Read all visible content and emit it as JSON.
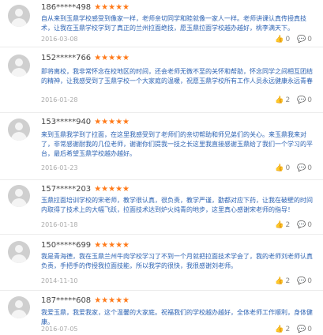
{
  "reviews": [
    {
      "user": "186*****498",
      "stars": "★★★★★",
      "content": "自从来到玉鼎学校感受到像家一样，老师亲切同学和睦就像一家人一样。老师讲课认真传授真技术，让我在玉鼎学校学到了真正的兰州拉面绝技，愿玉鼎拉面学校越办越好，桃李满天下。",
      "date": "2016-03-08",
      "likes": "0",
      "comments": "0"
    },
    {
      "user": "152*****766",
      "stars": "★★★★★",
      "content": "即将离校，我非常怀念在校地区的时间，还会老师无微不至的关怀和帮助，怀念同学之间相互团结的精神，让我感受到了玉鼎学校一个大家庭的温暖，祝愿玉鼎学校所有工作人员永远健康永远青春",
      "date": "2016-01-28",
      "likes": "2",
      "comments": "0"
    },
    {
      "user": "153*****940",
      "stars": "★★★★★",
      "content": "来到玉鼎我学到了拉面，在这里我感受到了老师们的亲切帮助和师兄弟们的关心。来玉鼎我来对了，非常感谢耐我的几位老师，谢谢你们提我一技之长这里我直接感谢玉鼎给了我们一个学习的平台，最后希望玉鼎学校越办越好。",
      "date": "2016-01-23",
      "likes": "0",
      "comments": "0"
    },
    {
      "user": "157*****203",
      "stars": "★★★★★",
      "content": "玉鼎拉面培训学校的宋老师，教学很认真，很负责，教学严谨，勤都对应下药，让我在破壁的时间内取得了技术上的大幅飞跃，拉面技术达到炉火纯青的地步，这里真心感谢宋老师的指导！",
      "date": "2016-01-18",
      "likes": "2",
      "comments": "0"
    },
    {
      "user": "150*****699",
      "stars": "★★★★★",
      "content": "我是青海德，我在玉鼎兰州牛肉学校学习了不到一个月就把拉面技术学会了，我的老师刘老师认真负责，手把手的传授我拉面技能，所以我学的很快，我很感谢刘老师。",
      "date": "2014-11-10",
      "likes": "2",
      "comments": "0"
    },
    {
      "user": "187*****608",
      "stars": "★★★★★",
      "content": "我爱玉鼎，我爱我家，这个温馨的大家庭。祝福我们的学校越办越好，全体老师工作顺利，身体健康。",
      "date": "2016-07-05",
      "likes": "2",
      "comments": "0"
    }
  ]
}
